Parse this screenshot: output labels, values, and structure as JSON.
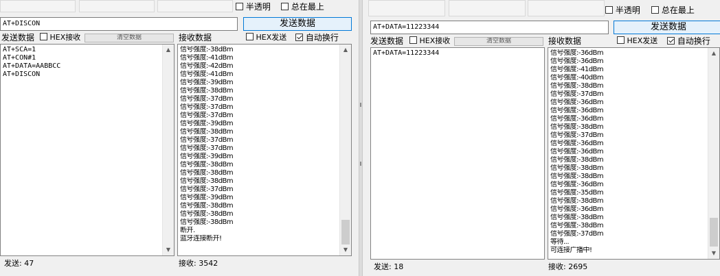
{
  "left": {
    "opt_translucent": "半透明",
    "opt_topmost": "总在最上",
    "send_input_value": "AT+DISCON",
    "send_button": "发送数据",
    "send_label": "发送数据",
    "hex_recv_label": "HEX接收",
    "clear_button": "清空数据",
    "recv_label": "接收数据",
    "hex_send_label": "HEX发送",
    "auto_wrap_label": "自动换行",
    "send_lines": [
      "AT+SCA=1",
      "AT+CON#1",
      "AT+DATA=AABBCC",
      "AT+DISCON"
    ],
    "recv_lines": [
      "信号强度:-38dBm",
      "信号强度:-41dBm",
      "信号强度:-42dBm",
      "信号强度:-41dBm",
      "信号强度:-39dBm",
      "信号强度:-38dBm",
      "信号强度:-37dBm",
      "信号强度:-37dBm",
      "信号强度:-37dBm",
      "信号强度:-39dBm",
      "信号强度:-38dBm",
      "信号强度:-37dBm",
      "信号强度:-37dBm",
      "信号强度:-39dBm",
      "信号强度:-38dBm",
      "信号强度:-38dBm",
      "信号强度:-38dBm",
      "信号强度:-37dBm",
      "信号强度:-39dBm",
      "信号强度:-38dBm",
      "信号强度:-38dBm",
      "信号强度:-38dBm",
      "断开.",
      "蓝牙连接断开!"
    ],
    "status_sent": "发送: 47",
    "status_recv": "接收:  3542"
  },
  "right": {
    "opt_translucent": "半透明",
    "opt_topmost": "总在最上",
    "send_input_value": "AT+DATA=11223344",
    "send_button": "发送数据",
    "send_label": "发送数据",
    "hex_recv_label": "HEX接收",
    "clear_button": "清空数据",
    "recv_label": "接收数据",
    "hex_send_label": "HEX发送",
    "auto_wrap_label": "自动换行",
    "send_lines": [
      "AT+DATA=11223344"
    ],
    "recv_lines": [
      "信号强度:-36dBm",
      "信号强度:-36dBm",
      "信号强度:-41dBm",
      "信号强度:-40dBm",
      "信号强度:-38dBm",
      "信号强度:-37dBm",
      "信号强度:-36dBm",
      "信号强度:-36dBm",
      "信号强度:-36dBm",
      "信号强度:-38dBm",
      "信号强度:-37dBm",
      "信号强度:-36dBm",
      "信号强度:-36dBm",
      "信号强度:-38dBm",
      "信号强度:-38dBm",
      "信号强度:-38dBm",
      "信号强度:-36dBm",
      "信号强度:-35dBm",
      "信号强度:-38dBm",
      "信号强度:-36dBm",
      "信号强度:-38dBm",
      "信号强度:-38dBm",
      "信号强度:-37dBm",
      "等待...",
      "可连接广播中!"
    ],
    "status_sent": "发送: 18",
    "status_recv": "接收:  2695"
  }
}
